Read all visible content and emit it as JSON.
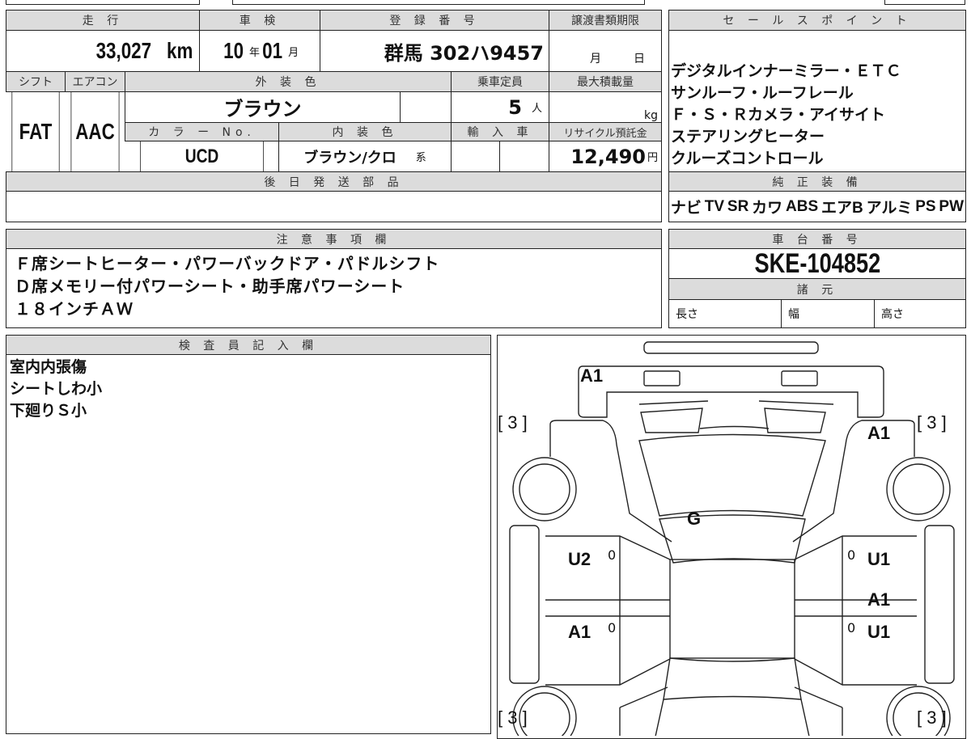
{
  "vehicle_info": {
    "mileage_label": "走 行",
    "mileage_value": "33,027",
    "mileage_unit": "km",
    "inspection_label": "車 検",
    "inspection_year": "10",
    "year_unit": "年",
    "inspection_month": "01",
    "month_unit": "月",
    "registration_label": "登 録 番 号",
    "registration_value": "群馬 302ハ9457",
    "transfer_label": "譲渡書類期限",
    "transfer_month": "月",
    "transfer_day": "日",
    "shift_label": "シフト",
    "shift_value": "FAT",
    "ac_label": "エアコン",
    "ac_value": "AAC",
    "exterior_label": "外 装 色",
    "exterior_value": "ブラウン",
    "capacity_label": "乗車定員",
    "capacity_value": "5",
    "capacity_unit": "人",
    "max_load_label": "最大積載量",
    "max_load_unit": "kg",
    "color_no_label": "カ ラ ー No.",
    "color_no_value": "UCD",
    "interior_label": "内 装 色",
    "interior_value": "ブラウン/クロ",
    "interior_suffix": "系",
    "import_label": "輸 入 車",
    "recycle_label": "リサイクル預託金",
    "recycle_value": "12,490",
    "recycle_unit": "円",
    "later_parts_label": "後 日 発 送 部 品"
  },
  "sales_points": {
    "label": "セ ー ル ス ポ イ ン ト",
    "lines": [
      "デジタルインナーミラー・ＥＴＣ",
      "サンルーフ・ルーフレール",
      "Ｆ・Ｓ・Ｒカメラ・アイサイト",
      "ステアリングヒーター",
      "クルーズコントロール"
    ]
  },
  "equipment": {
    "label": "純 正 装 備",
    "items": [
      "ナビ",
      "TV",
      "SR",
      "カワ",
      "ABS",
      "エアB",
      "アルミ",
      "PS",
      "PW"
    ]
  },
  "notes": {
    "label": "注 意 事 項 欄",
    "lines": [
      "Ｆ席シートヒーター・パワーバックドア・パドルシフト",
      "Ｄ席メモリー付パワーシート・助手席パワーシート",
      "１８インチＡＷ"
    ]
  },
  "chassis": {
    "label": "車 台 番 号",
    "value": "SKE-104852",
    "spec_label": "諸 元",
    "length": "長さ",
    "width": "幅",
    "height": "高さ"
  },
  "inspector": {
    "label": "検 査 員 記 入 欄",
    "lines": [
      "室内内張傷",
      "シートしわ小",
      "下廻りＳ小"
    ]
  },
  "diagram": {
    "marks": {
      "rear_bumper": "A1",
      "front_left_tire": "[ 3 ]",
      "front_right_tire": "[ 3 ]",
      "front_right_fender": "A1",
      "windshield": "G",
      "left_front_door": "U2",
      "right_front_door": "U1",
      "right_rear_door_a": "A1",
      "left_rear_door": "A1",
      "right_rear_door_u": "U1",
      "rear_left_tire": "[ 3 ]",
      "rear_right_tire": "[ 3 ]",
      "zero": "0"
    }
  }
}
